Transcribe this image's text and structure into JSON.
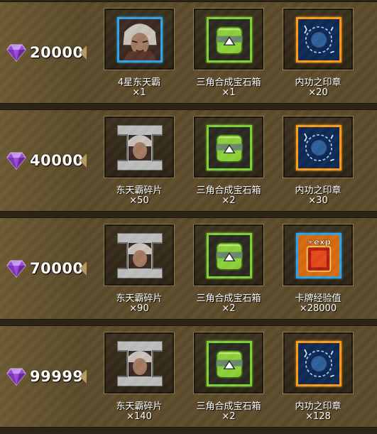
{
  "rewards": [
    {
      "cost": "20000",
      "items": [
        {
          "name": "4星东天霸",
          "qty": "×1",
          "icon": "hero-portrait-icon",
          "frame": "blue"
        },
        {
          "name": "三角合成宝石箱",
          "qty": "×1",
          "icon": "gem-chest-icon",
          "frame": "green"
        },
        {
          "name": "内功之印章",
          "qty": "×20",
          "icon": "seal-stamp-icon",
          "frame": "orange"
        }
      ]
    },
    {
      "cost": "40000",
      "items": [
        {
          "name": "东天霸碎片",
          "qty": "×50",
          "icon": "hero-fragment-icon",
          "frame": "silver"
        },
        {
          "name": "三角合成宝石箱",
          "qty": "×2",
          "icon": "gem-chest-icon",
          "frame": "green"
        },
        {
          "name": "内功之印章",
          "qty": "×30",
          "icon": "seal-stamp-icon",
          "frame": "orange"
        }
      ]
    },
    {
      "cost": "70000",
      "items": [
        {
          "name": "东天霸碎片",
          "qty": "×90",
          "icon": "hero-fragment-icon",
          "frame": "silver"
        },
        {
          "name": "三角合成宝石箱",
          "qty": "×2",
          "icon": "gem-chest-icon",
          "frame": "green"
        },
        {
          "name": "卡牌经验值",
          "qty": "×28000",
          "icon": "card-exp-icon",
          "frame": "blue"
        }
      ]
    },
    {
      "cost": "99999",
      "items": [
        {
          "name": "东天霸碎片",
          "qty": "×140",
          "icon": "hero-fragment-icon",
          "frame": "silver"
        },
        {
          "name": "三角合成宝石箱",
          "qty": "×2",
          "icon": "gem-chest-icon",
          "frame": "green"
        },
        {
          "name": "内功之印章",
          "qty": "×128",
          "icon": "seal-stamp-icon",
          "frame": "orange"
        }
      ]
    }
  ],
  "card_exp_badge": "+exp",
  "colors": {
    "frame_blue": "#2fa4e8",
    "frame_green": "#7ed234",
    "frame_orange": "#ff9a1a",
    "gem": "#9b4fd6"
  }
}
